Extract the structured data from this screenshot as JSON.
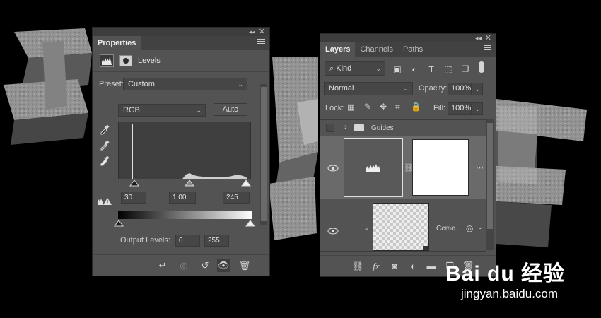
{
  "properties_panel": {
    "tab_label": "Properties",
    "adjustment_title": "Levels",
    "preset_label": "Preset:",
    "preset_value": "Custom",
    "channel_value": "RGB",
    "auto_button": "Auto",
    "input_black": "30",
    "input_gamma": "1.00",
    "input_white": "245",
    "output_label": "Output Levels:",
    "output_black": "0",
    "output_white": "255"
  },
  "layers_panel": {
    "tabs": [
      "Layers",
      "Channels",
      "Paths"
    ],
    "filter_kind": "Kind",
    "blend_mode": "Normal",
    "opacity_label": "Opacity:",
    "opacity_value": "100%",
    "lock_label": "Lock:",
    "fill_label": "Fill:",
    "fill_value": "100%",
    "layers": [
      {
        "name": "Guides",
        "type": "group"
      },
      {
        "name": "",
        "type": "levels-adjustment"
      },
      {
        "name": "Ceme...",
        "type": "smart-object"
      }
    ]
  },
  "watermark": {
    "logo": "Bai du 经验",
    "url": "jingyan.baidu.com"
  },
  "colors": {
    "panel_bg": "#535353",
    "panel_dark": "#424242",
    "field_bg": "#464646",
    "canvas_bg": "#000000"
  }
}
